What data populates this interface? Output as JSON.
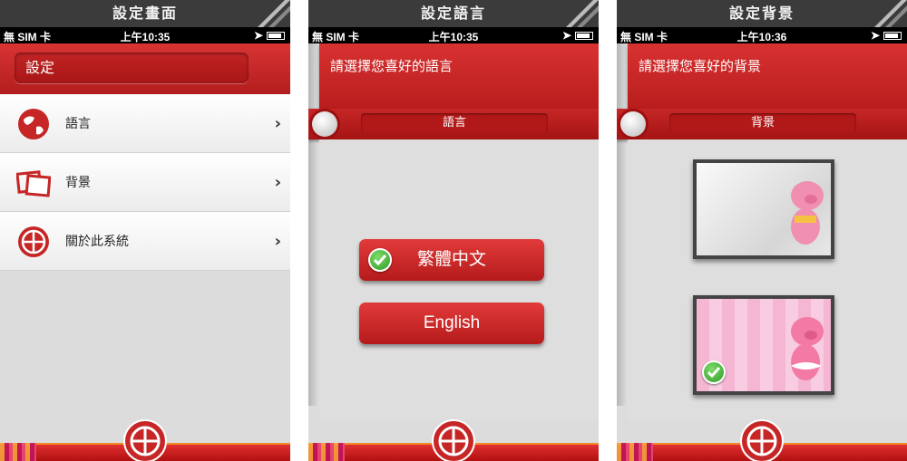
{
  "screens": {
    "settings": {
      "caption": "設定畫面",
      "status": {
        "carrier": "無 SIM 卡",
        "time": "上午10:35"
      },
      "header_field": "設定",
      "menu": [
        {
          "label": "語言",
          "icon": "globe-icon"
        },
        {
          "label": "背景",
          "icon": "picture-frame-icon"
        },
        {
          "label": "關於此系統",
          "icon": "bank-logo-icon"
        }
      ]
    },
    "language": {
      "caption": "設定語言",
      "status": {
        "carrier": "無 SIM 卡",
        "time": "上午10:35"
      },
      "prompt": "請選擇您喜好的語言",
      "tab": "語言",
      "options": [
        {
          "label": "繁體中文",
          "selected": true
        },
        {
          "label": "English",
          "selected": false
        }
      ]
    },
    "background": {
      "caption": "設定背景",
      "status": {
        "carrier": "無 SIM 卡",
        "time": "上午10:36"
      },
      "prompt": "請選擇您喜好的背景",
      "tab": "背景",
      "options": [
        {
          "theme": "white-pig",
          "selected": false
        },
        {
          "theme": "pink-pig",
          "selected": true
        }
      ]
    }
  },
  "colors": {
    "brand_red": "#c62626",
    "caption_bg": "#3b3b3b",
    "check_green": "#2e9a26"
  }
}
